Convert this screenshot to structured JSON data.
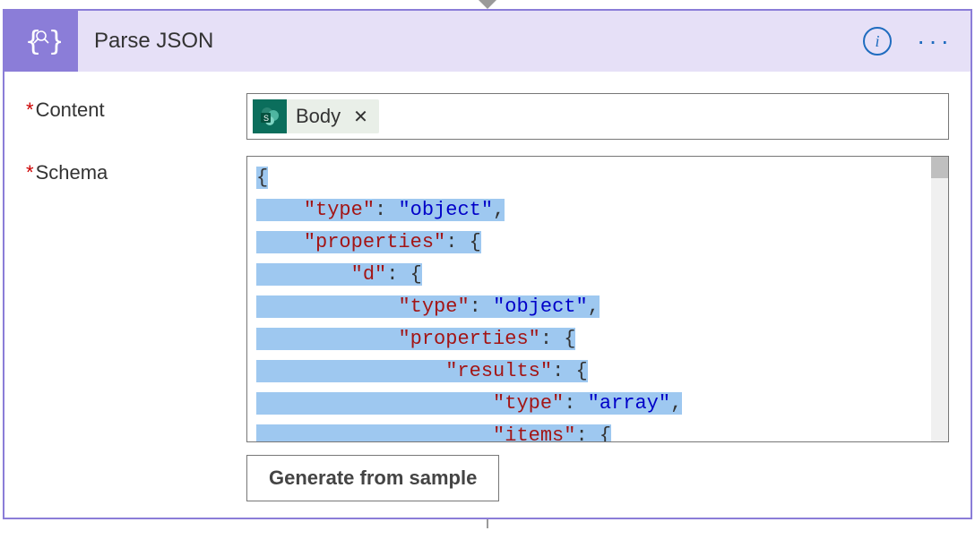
{
  "header": {
    "title": "Parse JSON"
  },
  "fields": {
    "content": {
      "label": "Content"
    },
    "schema": {
      "label": "Schema"
    }
  },
  "contentToken": {
    "text": "Body",
    "iconLetter": "S"
  },
  "schemaTokens": [
    [
      [
        "p",
        "{"
      ]
    ],
    [
      [
        "sp",
        "    "
      ],
      [
        "k",
        "\"type\""
      ],
      [
        "p",
        ": "
      ],
      [
        "v",
        "\"object\""
      ],
      [
        "p",
        ","
      ]
    ],
    [
      [
        "sp",
        "    "
      ],
      [
        "k",
        "\"properties\""
      ],
      [
        "p",
        ": {"
      ]
    ],
    [
      [
        "sp",
        "        "
      ],
      [
        "k",
        "\"d\""
      ],
      [
        "p",
        ": {"
      ]
    ],
    [
      [
        "sp",
        "            "
      ],
      [
        "k",
        "\"type\""
      ],
      [
        "p",
        ": "
      ],
      [
        "v",
        "\"object\""
      ],
      [
        "p",
        ","
      ]
    ],
    [
      [
        "sp",
        "            "
      ],
      [
        "k",
        "\"properties\""
      ],
      [
        "p",
        ": {"
      ]
    ],
    [
      [
        "sp",
        "                "
      ],
      [
        "k",
        "\"results\""
      ],
      [
        "p",
        ": {"
      ]
    ],
    [
      [
        "sp",
        "                    "
      ],
      [
        "k",
        "\"type\""
      ],
      [
        "p",
        ": "
      ],
      [
        "v",
        "\"array\""
      ],
      [
        "p",
        ","
      ]
    ],
    [
      [
        "sp",
        "                    "
      ],
      [
        "k",
        "\"items\""
      ],
      [
        "p",
        ": {"
      ]
    ]
  ],
  "generateButton": {
    "label": "Generate from sample"
  }
}
